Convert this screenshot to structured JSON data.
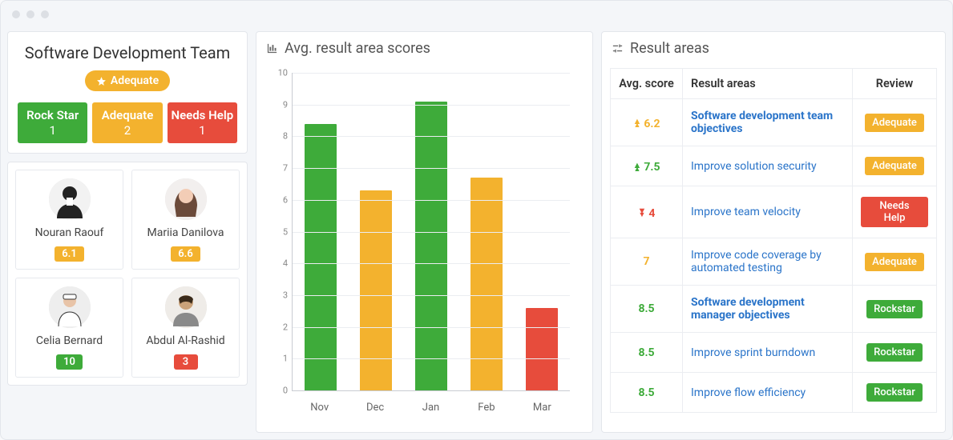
{
  "team": {
    "title": "Software Development Team",
    "status_label": "Adequate",
    "stats": [
      {
        "label": "Rock Star",
        "count": "1",
        "color": "green"
      },
      {
        "label": "Adequate",
        "count": "2",
        "color": "yellow"
      },
      {
        "label": "Needs Help",
        "count": "1",
        "color": "red"
      }
    ]
  },
  "members": [
    {
      "name": "Nouran Raouf",
      "score": "6.1",
      "color": "yellow"
    },
    {
      "name": "Mariia Danilova",
      "score": "6.6",
      "color": "yellow"
    },
    {
      "name": "Celia Bernard",
      "score": "10",
      "color": "green"
    },
    {
      "name": "Abdul Al-Rashid",
      "score": "3",
      "color": "red"
    }
  ],
  "chart_title": "Avg. result area scores",
  "chart_data": {
    "type": "bar",
    "categories": [
      "Nov",
      "Dec",
      "Jan",
      "Feb",
      "Mar"
    ],
    "values": [
      8.4,
      6.3,
      9.1,
      6.7,
      2.6
    ],
    "colors": [
      "#3eab3a",
      "#f3b22e",
      "#3eab3a",
      "#f3b22e",
      "#e74c3c"
    ],
    "title": "Avg. result area scores",
    "xlabel": "",
    "ylabel": "",
    "ylim": [
      0,
      10
    ],
    "yticks": [
      0,
      1,
      2,
      3,
      4,
      5,
      6,
      7,
      8,
      9,
      10
    ]
  },
  "result_areas": {
    "title": "Result areas",
    "headers": {
      "score": "Avg. score",
      "area": "Result areas",
      "review": "Review"
    },
    "rows": [
      {
        "score": "6.2",
        "arrow": "up",
        "score_color": "yellow",
        "area": "Software development team objectives",
        "bold": true,
        "review": "Adequate",
        "review_color": "yellow"
      },
      {
        "score": "7.5",
        "arrow": "up",
        "score_color": "green",
        "area": "Improve solution security",
        "bold": false,
        "review": "Adequate",
        "review_color": "yellow"
      },
      {
        "score": "4",
        "arrow": "down",
        "score_color": "red",
        "area": "Improve team velocity",
        "bold": false,
        "review": "Needs Help",
        "review_color": "red"
      },
      {
        "score": "7",
        "arrow": "",
        "score_color": "yellow",
        "area": "Improve code coverage by automated testing",
        "bold": false,
        "review": "Adequate",
        "review_color": "yellow"
      },
      {
        "score": "8.5",
        "arrow": "",
        "score_color": "green",
        "area": "Software development manager objectives",
        "bold": true,
        "review": "Rockstar",
        "review_color": "green"
      },
      {
        "score": "8.5",
        "arrow": "",
        "score_color": "green",
        "area": "Improve sprint burndown",
        "bold": false,
        "review": "Rockstar",
        "review_color": "green"
      },
      {
        "score": "8.5",
        "arrow": "",
        "score_color": "green",
        "area": "Improve flow efficiency",
        "bold": false,
        "review": "Rockstar",
        "review_color": "green"
      }
    ]
  }
}
